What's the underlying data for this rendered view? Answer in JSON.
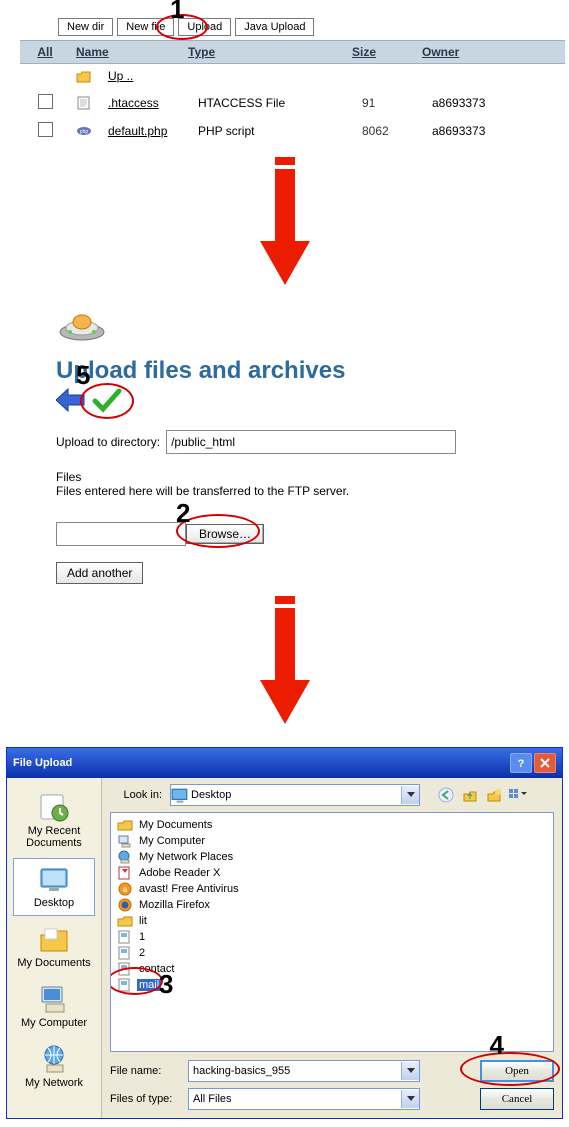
{
  "callouts": {
    "n1": "1",
    "n2": "2",
    "n3": "3",
    "n4": "4",
    "n5": "5"
  },
  "filemgr": {
    "toolbar": {
      "newdir": "New dir",
      "newfile": "New file",
      "upload": "Upload",
      "javaupload": "Java Upload"
    },
    "headers": {
      "all": "All",
      "name": "Name",
      "type": "Type",
      "size": "Size",
      "owner": "Owner"
    },
    "rows": [
      {
        "name": "Up ..",
        "type": "",
        "size": "",
        "owner": "",
        "icon": "folder"
      },
      {
        "name": ".htaccess",
        "type": "HTACCESS File",
        "size": "91",
        "owner": "a8693373",
        "icon": "file"
      },
      {
        "name": "default.php",
        "type": "PHP script",
        "size": "8062",
        "owner": "a8693373",
        "icon": "php"
      }
    ]
  },
  "uploadform": {
    "heading": "Upload files and archives",
    "dirlabel": "Upload to directory:",
    "dirvalue": "/public_html",
    "fileslabel": "Files",
    "filesnote": "Files entered here will be transferred to the FTP server.",
    "browse": "Browse…",
    "addanother": "Add another"
  },
  "dialog": {
    "title": "File Upload",
    "lookin_label": "Look in:",
    "lookin_value": "Desktop",
    "places": [
      {
        "label": "My Recent Documents",
        "icon": "recent"
      },
      {
        "label": "Desktop",
        "icon": "desktop",
        "selected": true
      },
      {
        "label": "My Documents",
        "icon": "mydocs"
      },
      {
        "label": "My Computer",
        "icon": "mycomp"
      },
      {
        "label": "My Network",
        "icon": "mynet"
      }
    ],
    "items": [
      {
        "label": "My Documents",
        "icon": "folder-y"
      },
      {
        "label": "My Computer",
        "icon": "mycomp-s"
      },
      {
        "label": "My Network Places",
        "icon": "mynet-s"
      },
      {
        "label": "Adobe Reader X",
        "icon": "app-red"
      },
      {
        "label": "avast! Free Antivirus",
        "icon": "app-orange"
      },
      {
        "label": "Mozilla Firefox",
        "icon": "app-orange"
      },
      {
        "label": "lit",
        "icon": "folder-y"
      },
      {
        "label": "1",
        "icon": "doc"
      },
      {
        "label": "2",
        "icon": "doc"
      },
      {
        "label": "contact",
        "icon": "doc"
      },
      {
        "label": "mail",
        "icon": "doc",
        "selected": true
      }
    ],
    "filename_label": "File name:",
    "filename_value": "hacking-basics_955",
    "filetype_label": "Files of type:",
    "filetype_value": "All Files",
    "open": "Open",
    "cancel": "Cancel"
  }
}
